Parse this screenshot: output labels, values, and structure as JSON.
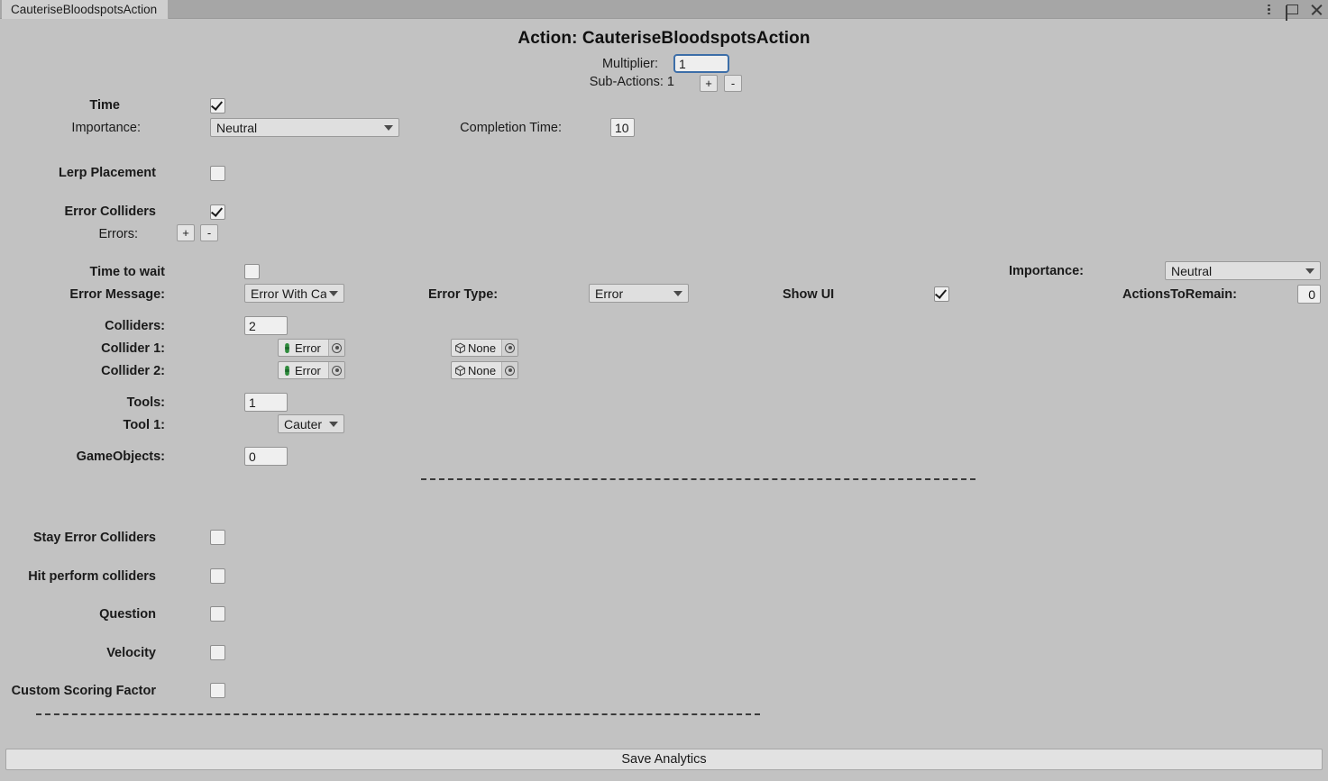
{
  "window": {
    "tab_label": "CauteriseBloodspotsAction",
    "controls": {
      "menu": "kebab-menu-icon",
      "maximize": "maximize-icon",
      "close": "close-icon"
    }
  },
  "header": {
    "title": "Action: CauteriseBloodspotsAction",
    "multiplier_label": "Multiplier:",
    "multiplier_value": "1",
    "subactions_label": "Sub-Actions: 1",
    "add_button": "+",
    "remove_button": "-"
  },
  "time_section": {
    "time_label": "Time",
    "time_checked": true,
    "importance_label": "Importance:",
    "importance_value": "Neutral",
    "completion_time_label": "Completion Time:",
    "completion_time_value": "10"
  },
  "lerp": {
    "label": "Lerp Placement",
    "checked": false
  },
  "error_colliders": {
    "label": "Error Colliders",
    "checked": true,
    "errors_label": "Errors:",
    "add_button": "+",
    "remove_button": "-"
  },
  "error_entry": {
    "time_to_wait_label": "Time to wait",
    "time_to_wait_checked": false,
    "error_message_label": "Error Message:",
    "error_message_value": "Error With Ca",
    "error_type_label": "Error Type:",
    "error_type_value": "Error",
    "show_ui_label": "Show UI",
    "show_ui_checked": true,
    "importance_label": "Importance:",
    "importance_value": "Neutral",
    "actions_to_remain_label": "ActionsToRemain:",
    "actions_to_remain_value": "0",
    "colliders_label": "Colliders:",
    "colliders_count": "2",
    "collider_rows": [
      {
        "label": "Collider 1:",
        "component_icon": "capsule-collider-icon",
        "component_value": "Error",
        "object_icon": "gameobject-cube-icon",
        "object_value": "None"
      },
      {
        "label": "Collider 2:",
        "component_icon": "capsule-collider-icon",
        "component_value": "Error",
        "object_icon": "gameobject-cube-icon",
        "object_value": "None"
      }
    ],
    "tools_label": "Tools:",
    "tools_count": "1",
    "tool_rows": [
      {
        "label": "Tool 1:",
        "value": "Cauter"
      }
    ],
    "gameobjects_label": "GameObjects:",
    "gameobjects_count": "0"
  },
  "toggles": [
    {
      "label": "Stay Error Colliders",
      "checked": false
    },
    {
      "label": "Hit perform colliders",
      "checked": false
    },
    {
      "label": "Question",
      "checked": false
    },
    {
      "label": "Velocity",
      "checked": false
    },
    {
      "label": "Custom Scoring Factor",
      "checked": false
    }
  ],
  "footer": {
    "save_label": "Save Analytics"
  },
  "colors": {
    "background": "#c2c2c2",
    "tabbar": "#a6a6a6",
    "field": "#efefef",
    "dropdown": "#dfdfdf",
    "focus_border": "#3c6ea8",
    "collider_icon": "#2e8b3c",
    "text": "#1a1a1a"
  }
}
